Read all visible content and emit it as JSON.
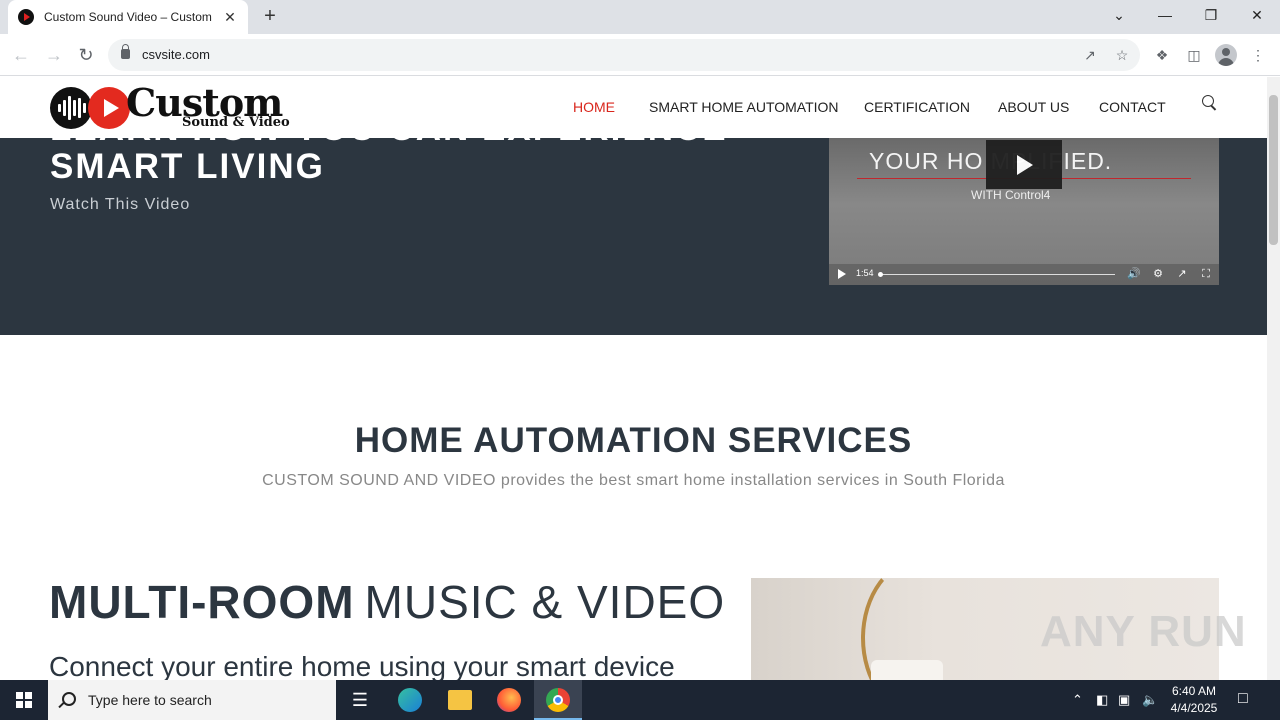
{
  "browser": {
    "tab_title": "Custom Sound Video – Custom",
    "tab_close": "✕",
    "new_tab": "+",
    "url": "csvsite.com",
    "window": {
      "minimize": "—",
      "restore": "❐",
      "close": "✕",
      "tab_search": "⌄"
    }
  },
  "site": {
    "logo_text": "Custom",
    "logo_sub": "Sound & Video",
    "nav": [
      {
        "label": "HOME",
        "active": true
      },
      {
        "label": "SMART HOME AUTOMATION",
        "active": false
      },
      {
        "label": "CERTIFICATION",
        "active": false
      },
      {
        "label": "ABOUT US",
        "active": false
      },
      {
        "label": "CONTACT",
        "active": false
      }
    ]
  },
  "hero": {
    "title": "LEARN HOW YOU CAN EXPERIENCE SMART LIVING",
    "subtitle": "Watch This Video",
    "video": {
      "text": "YOUR HO  MPLIFIED.",
      "sub": "WITH Control4",
      "time": "1:54"
    }
  },
  "services": {
    "title": "HOME AUTOMATION SERVICES",
    "subtitle": "CUSTOM SOUND AND VIDEO provides the best smart home installation services in South Florida"
  },
  "multiroom": {
    "title_bold": "MULTI-ROOM",
    "title_light": "MUSIC & VIDEO",
    "text": "Connect your entire home using your smart device"
  },
  "watermark": "ANY RUN",
  "taskbar": {
    "search_placeholder": "Type here to search",
    "time": "6:40 AM",
    "date": "4/4/2025"
  },
  "colors": {
    "accent": "#d9261c",
    "hero_bg": "#2c3640",
    "taskbar": "#1c2533"
  }
}
